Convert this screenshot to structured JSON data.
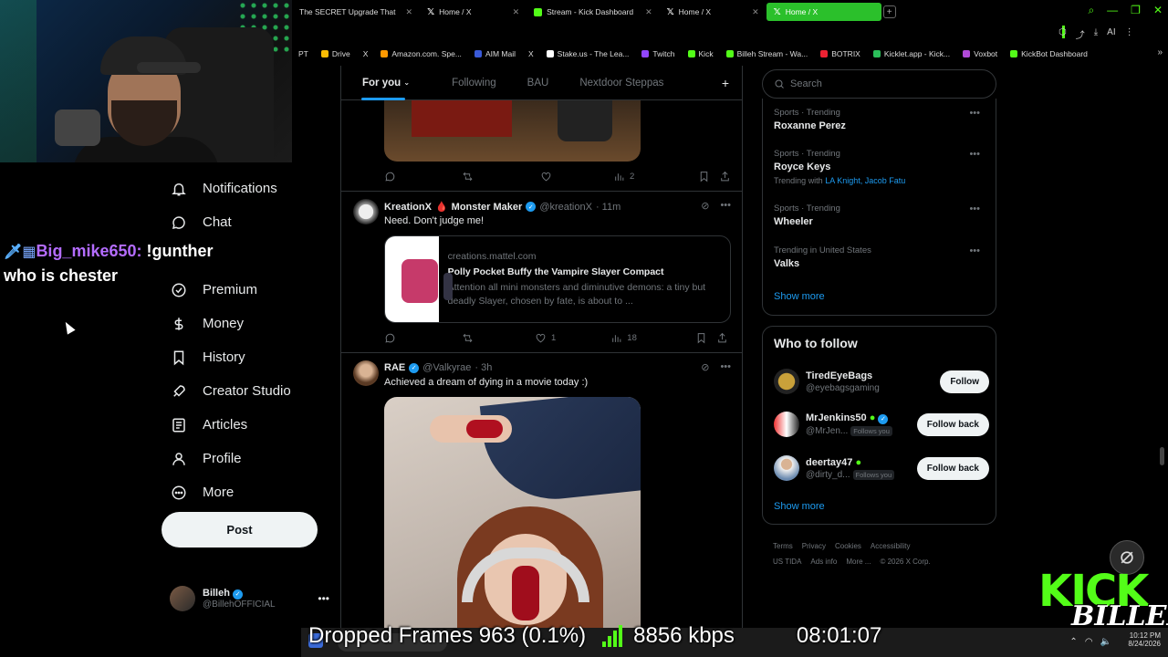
{
  "browser": {
    "tabs": [
      {
        "label": "The SECRET Upgrade That",
        "icon": "none",
        "active": false
      },
      {
        "label": "Home / X",
        "icon": "x-logo",
        "active": false
      },
      {
        "label": "Stream - Kick Dashboard",
        "icon": "kick-logo",
        "active": false
      },
      {
        "label": "Home / X",
        "icon": "x-logo",
        "active": false
      },
      {
        "label": "Home / X",
        "icon": "x-logo",
        "active": true
      }
    ],
    "bookmarks": [
      "PT",
      "Drive",
      "X",
      "Amazon.com. Spe...",
      "AIM Mail",
      "X",
      "Stake.us - The Lea...",
      "Twitch",
      "Kick",
      "Billeh Stream - Wa...",
      "BOTRIX",
      "Kicklet.app - Kick...",
      "Voxbot",
      "KickBot Dashboard"
    ]
  },
  "chat": {
    "username": "Big_mike650:",
    "command": "!gunther",
    "message": "who is chester"
  },
  "nav": {
    "items": [
      {
        "label": "Notifications",
        "icon": "bell-icon"
      },
      {
        "label": "Chat",
        "icon": "chat-icon"
      },
      {
        "label": "Premium",
        "icon": "premium-icon"
      },
      {
        "label": "Money",
        "icon": "money-icon"
      },
      {
        "label": "History",
        "icon": "bookmark-icon"
      },
      {
        "label": "Creator Studio",
        "icon": "rocket-icon"
      },
      {
        "label": "Articles",
        "icon": "articles-icon"
      },
      {
        "label": "Profile",
        "icon": "profile-icon"
      },
      {
        "label": "More",
        "icon": "more-icon"
      }
    ],
    "post_label": "Post",
    "account": {
      "name": "Billeh",
      "handle": "@BillehOFFICIAL"
    }
  },
  "feed": {
    "tabs": [
      "For you",
      "Following",
      "BAU",
      "Nextdoor Steppas"
    ],
    "top_tweet": {
      "views": "2"
    },
    "tweet1": {
      "name": "KreationX",
      "emoji": "🩸",
      "name2": "Monster Maker",
      "handle": "@kreationX",
      "time": "· 11m",
      "text": "Need.  Don't judge me!",
      "card": {
        "domain": "creations.mattel.com",
        "title": "Polly Pocket Buffy the Vampire Slayer Compact",
        "desc": "Attention all mini monsters and diminutive demons: a tiny but deadly Slayer, chosen by fate, is about to ..."
      },
      "likes": "1",
      "views": "18"
    },
    "tweet2": {
      "name": "RAE",
      "handle": "@Valkyrae",
      "time": "· 3h",
      "text": "Achieved a dream of dying in a movie today :)"
    }
  },
  "right": {
    "search_placeholder": "Search",
    "trends": [
      {
        "meta": "Sports · Trending",
        "title": "Roxanne Perez",
        "with": ""
      },
      {
        "meta": "Sports · Trending",
        "title": "Royce Keys",
        "with_prefix": "Trending with",
        "with": "LA Knight, Jacob Fatu"
      },
      {
        "meta": "Sports · Trending",
        "title": "Wheeler",
        "with": ""
      },
      {
        "meta": "Trending in United States",
        "title": "Valks",
        "with": ""
      }
    ],
    "show_more": "Show more",
    "who_to_follow": {
      "title": "Who to follow",
      "users": [
        {
          "name": "TiredEyeBags",
          "handle": "@eyebagsgaming",
          "follows_you": false,
          "button": "Follow"
        },
        {
          "name": "MrJenkins50",
          "handle": "@MrJen...",
          "follows_you": true,
          "button": "Follow back"
        },
        {
          "name": "deertay47",
          "handle": "@dirty_d...",
          "follows_you": true,
          "button": "Follow back"
        }
      ],
      "follows_you_label": "Follows you",
      "show_more": "Show more"
    },
    "footer": [
      "Terms",
      "Privacy",
      "Cookies",
      "Accessibility",
      "US TIDA",
      "Ads info",
      "More ...",
      "© 2026 X Corp."
    ]
  },
  "overlay": {
    "dropped_frames": "Dropped Frames 963 (0.1%)",
    "kbps": "8856 kbps",
    "uptime": "08:01:07",
    "kick_word": "KICK",
    "kick_sub": "BILLEH",
    "clock_time": "10:12 PM",
    "clock_date": "8/24/2026"
  },
  "colors": {
    "accent_blue": "#1d9bf0",
    "kick_green": "#53fc18",
    "chat_username": "#b46cff"
  }
}
